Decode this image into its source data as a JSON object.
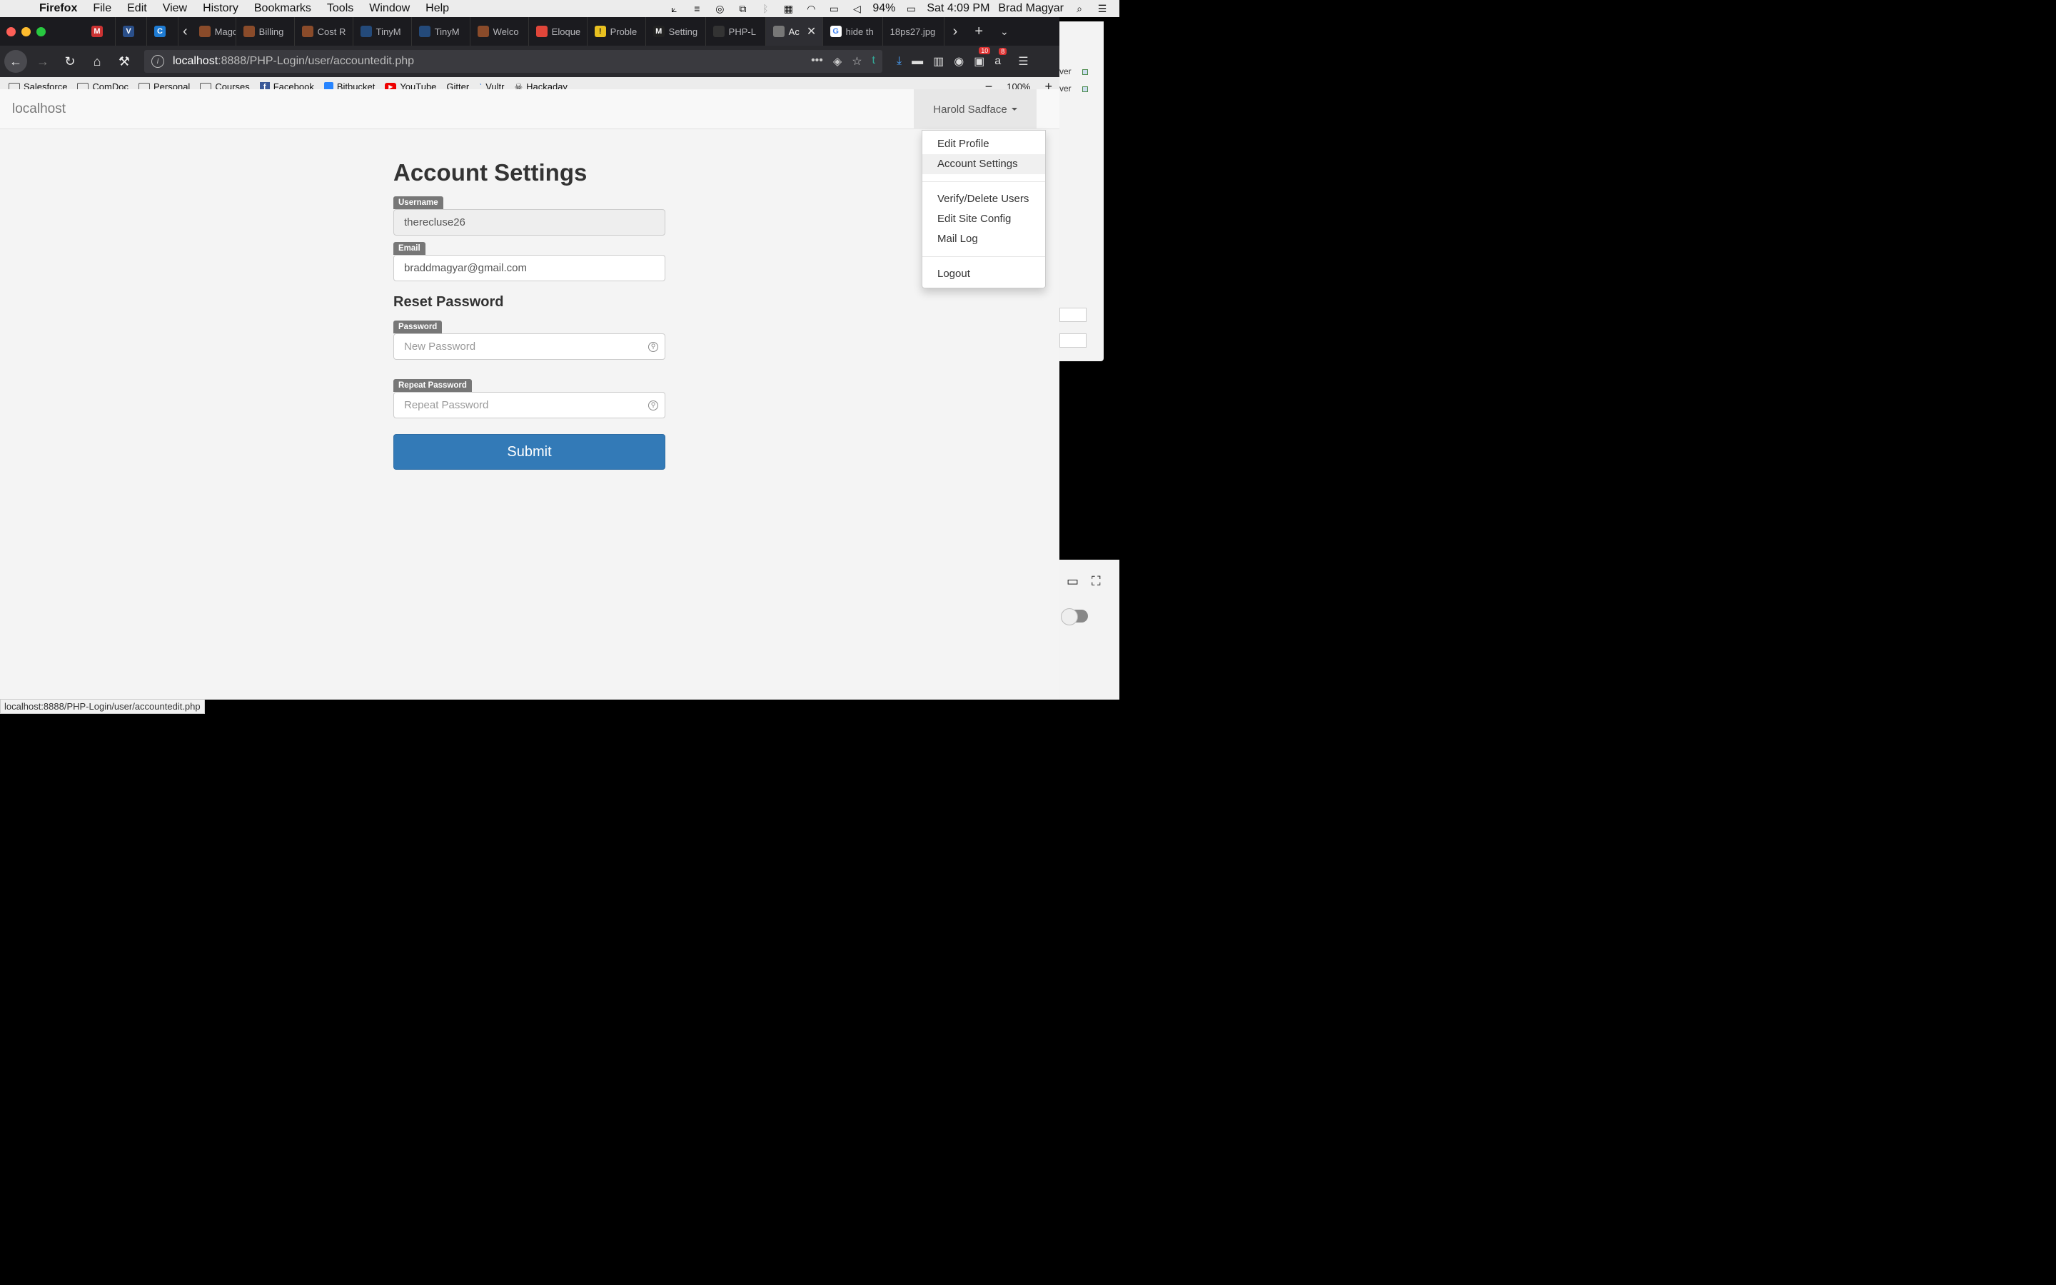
{
  "menubar": {
    "app": "Firefox",
    "items": [
      "File",
      "Edit",
      "View",
      "History",
      "Bookmarks",
      "Tools",
      "Window",
      "Help"
    ],
    "battery": "94%",
    "clock": "Sat 4:09 PM",
    "user": "Brad Magyar"
  },
  "tabs": [
    {
      "label": "",
      "icon": "gmail-icon",
      "color": "#c33"
    },
    {
      "label": "",
      "icon": "v-icon",
      "color": "#2a4f8a"
    },
    {
      "label": "",
      "icon": "c-icon",
      "color": "#1e7bd3"
    },
    {
      "label": "Magde",
      "icon": "magento-icon",
      "color": "#8a4b2a"
    },
    {
      "label": "Billing",
      "icon": "magento-icon",
      "color": "#8a4b2a"
    },
    {
      "label": "Cost R",
      "icon": "magento-icon",
      "color": "#8a4b2a"
    },
    {
      "label": "TinyM",
      "icon": "tinymce-icon",
      "color": "#244a7a"
    },
    {
      "label": "TinyM",
      "icon": "tinymce-icon",
      "color": "#244a7a"
    },
    {
      "label": "Welco",
      "icon": "magento-icon",
      "color": "#8a4b2a"
    },
    {
      "label": "Eloque",
      "icon": "laravel-icon",
      "color": "#e0463a"
    },
    {
      "label": "Proble",
      "icon": "warning-icon",
      "color": "#e8c020"
    },
    {
      "label": "Setting",
      "icon": "medium-icon",
      "color": "#222"
    },
    {
      "label": "PHP-L",
      "icon": "github-icon",
      "color": "#333"
    },
    {
      "label": "Ac",
      "icon": "site-icon",
      "color": "#777",
      "active": true
    },
    {
      "label": "hide th",
      "icon": "google-icon",
      "color": "#4285f4"
    },
    {
      "label": "18ps27.jpg",
      "icon": "",
      "color": ""
    }
  ],
  "url": {
    "host": "localhost",
    "path": ":8888/PHP-Login/user/accountedit.php"
  },
  "toolbar_badges": {
    "b1": "10",
    "b2": "8"
  },
  "bookmarks": [
    "Salesforce",
    "ComDoc",
    "Personal",
    "Courses",
    "Facebook",
    "Bitbucket",
    "YouTube",
    "Gitter",
    "Vultr",
    "Hackaday"
  ],
  "zoom": "100%",
  "site": {
    "brand": "localhost",
    "user_menu": "Harold Sadface",
    "dropdown": {
      "group1": [
        "Edit Profile",
        "Account Settings"
      ],
      "group2": [
        "Verify/Delete Users",
        "Edit Site Config",
        "Mail Log"
      ],
      "group3": [
        "Logout"
      ]
    }
  },
  "form": {
    "title": "Account Settings",
    "username_label": "Username",
    "username_value": "therecluse26",
    "email_label": "Email",
    "email_value": "braddmagyar@gmail.com",
    "reset_title": "Reset Password",
    "password_label": "Password",
    "password_placeholder": "New Password",
    "repeat_label": "Repeat Password",
    "repeat_placeholder": "Repeat Password",
    "submit": "Submit"
  },
  "statusbar": "localhost:8888/PHP-Login/user/accountedit.php",
  "bg_window": {
    "row1": "ver",
    "row2": "ver"
  }
}
